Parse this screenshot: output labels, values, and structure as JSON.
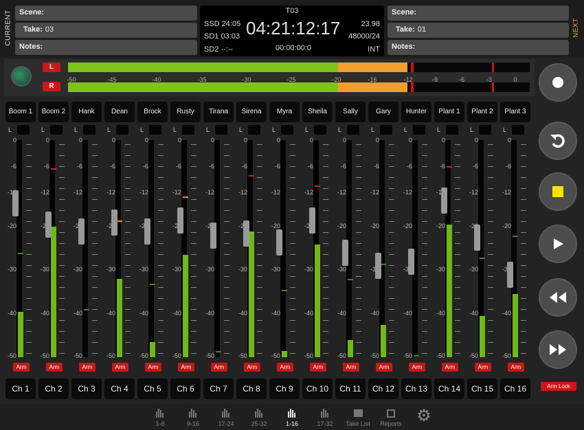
{
  "current": {
    "label": "CURRENT",
    "scene_label": "Scene:",
    "scene_value": "",
    "take_label": "Take:",
    "take_value": "03",
    "notes_label": "Notes:",
    "notes_value": ""
  },
  "next": {
    "label": "NEXT",
    "scene_label": "Scene:",
    "scene_value": "",
    "take_label": "Take:",
    "take_value": "01",
    "notes_label": "Notes:",
    "notes_value": ""
  },
  "timecode": {
    "take_name": "T03",
    "ssd": "SSD 24:05",
    "sd1": "SD1 03:03",
    "sd2": "SD2 --:--",
    "main": "04:21:12:17",
    "fps": "23.98",
    "rate": "48000/24",
    "sub": "00:00:00:0",
    "source": "INT"
  },
  "master_meter": {
    "left_label": "L",
    "right_label": "R",
    "scale": [
      "-50",
      "-45",
      "-40",
      "-35",
      "-30",
      "-25",
      "-20",
      "-16",
      "-12",
      "-9",
      "-6",
      "-3",
      "0"
    ],
    "green_frac": 0.585,
    "orange_frac": 0.735
  },
  "scale_labels": [
    "0",
    "-6",
    "-12",
    "-20",
    "-30",
    "-40",
    "-50"
  ],
  "channels": [
    {
      "name": "Boom 1",
      "ch": "Ch 1",
      "level": 0.21,
      "peak": 0.48,
      "fader": 0.71
    },
    {
      "name": "Boom 2",
      "ch": "Ch 2",
      "level": 0.6,
      "peak": 0.87,
      "fader": 0.61
    },
    {
      "name": "Hank",
      "ch": "Ch 3",
      "level": 0.0,
      "peak": 0.22,
      "fader": 0.58
    },
    {
      "name": "Dean",
      "ch": "Ch 4",
      "level": 0.36,
      "peak": 0.63,
      "fader": 0.62
    },
    {
      "name": "Brock",
      "ch": "Ch 5",
      "level": 0.07,
      "peak": 0.34,
      "fader": 0.58
    },
    {
      "name": "Rusty",
      "ch": "Ch 6",
      "level": 0.47,
      "peak": 0.74,
      "fader": 0.63
    },
    {
      "name": "Tirana",
      "ch": "Ch 7",
      "level": 0.0,
      "peak": 0.03,
      "fader": 0.56
    },
    {
      "name": "Sirena",
      "ch": "Ch 8",
      "level": 0.58,
      "peak": 0.84,
      "fader": 0.57
    },
    {
      "name": "Myra",
      "ch": "Ch 9",
      "level": 0.03,
      "peak": 0.31,
      "fader": 0.53
    },
    {
      "name": "Sheila",
      "ch": "Ch 10",
      "level": 0.52,
      "peak": 0.79,
      "fader": 0.63
    },
    {
      "name": "Sally",
      "ch": "Ch 11",
      "level": 0.08,
      "peak": 0.36,
      "fader": 0.48
    },
    {
      "name": "Gary",
      "ch": "Ch 12",
      "level": 0.15,
      "peak": 0.43,
      "fader": 0.42
    },
    {
      "name": "Hunter",
      "ch": "Ch 13",
      "level": 0.0,
      "peak": 0.01,
      "fader": 0.44
    },
    {
      "name": "Plant 1",
      "ch": "Ch 14",
      "level": 0.61,
      "peak": 0.88,
      "fader": 0.72
    },
    {
      "name": "Plant 2",
      "ch": "Ch 15",
      "level": 0.19,
      "peak": 0.46,
      "fader": 0.55
    },
    {
      "name": "Plant 3",
      "ch": "Ch 16",
      "level": 0.29,
      "peak": 0.56,
      "fader": 0.38
    }
  ],
  "arm_label": "Arm",
  "arm_lock_label": "Arm Lock",
  "transport": [
    {
      "name": "record"
    },
    {
      "name": "undo"
    },
    {
      "name": "stop"
    },
    {
      "name": "play"
    },
    {
      "name": "rewind"
    },
    {
      "name": "fast-forward"
    }
  ],
  "tabs": [
    {
      "label": "1-8",
      "icon": "meter-bars-icon",
      "active": false
    },
    {
      "label": "9-16",
      "icon": "meter-bars-icon",
      "active": false
    },
    {
      "label": "17-24",
      "icon": "meter-bars-icon",
      "active": false
    },
    {
      "label": "25-32",
      "icon": "meter-bars-icon",
      "active": false
    },
    {
      "label": "1-16",
      "icon": "meter-bars-icon",
      "active": true
    },
    {
      "label": "17-32",
      "icon": "meter-bars-icon",
      "active": false
    },
    {
      "label": "Take List",
      "icon": "clapperboard-icon",
      "active": false
    },
    {
      "label": "Reports",
      "icon": "edit-icon",
      "active": false
    },
    {
      "label": "",
      "icon": "gear-icon",
      "active": false
    }
  ],
  "colors": {
    "accent_red": "#c81818",
    "meter_green": "#7ec418",
    "meter_orange": "#f0a030",
    "stop_yellow": "#ffe000"
  }
}
